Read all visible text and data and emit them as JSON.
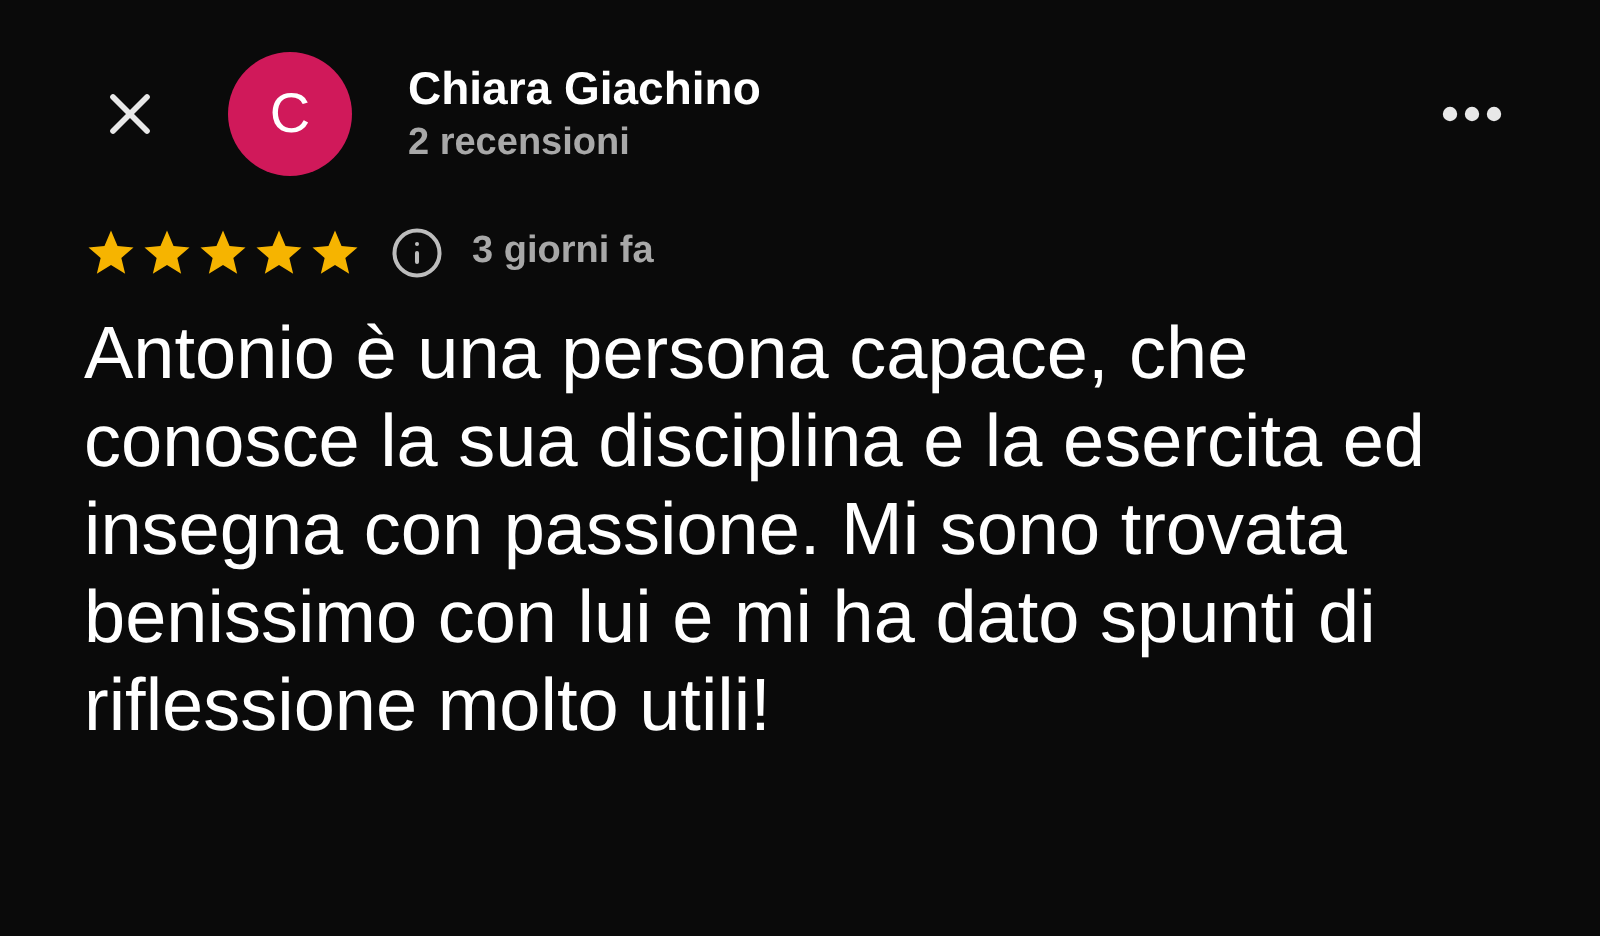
{
  "header": {
    "avatar_letter": "C",
    "name": "Chiara Giachino",
    "subtitle": "2 recensioni"
  },
  "rating": {
    "stars": 5,
    "time": "3 giorni fa"
  },
  "review": "Antonio è una persona capace, che conosce la sua disciplina e la esercita ed insegna con passione. Mi sono trovata benissimo con lui e mi ha dato spunti di riflessione molto utili!"
}
